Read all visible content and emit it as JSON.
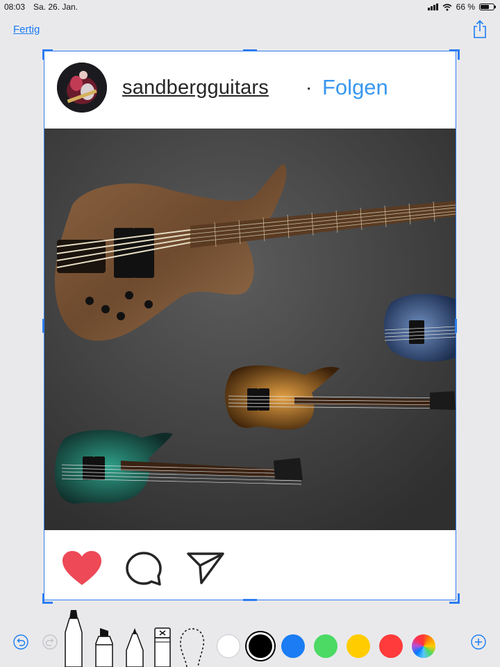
{
  "status_bar": {
    "time": "08:03",
    "date": "Sa. 26. Jan.",
    "battery_text": "66 %",
    "battery_level": 0.66
  },
  "nav": {
    "done_label": "Fertig",
    "share_icon": "share-icon"
  },
  "post": {
    "username": "sandbergguitars",
    "separator": "·",
    "follow_label": "Folgen",
    "image_subject": "bass-guitars-photo",
    "actions": [
      "heart-icon",
      "comment-icon",
      "send-icon"
    ]
  },
  "markup_toolbar": {
    "tools": [
      "undo-icon",
      "redo-icon",
      "marker-pen",
      "highlighter",
      "pencil",
      "eraser",
      "lasso"
    ],
    "colors": [
      "#ffffff",
      "#000000",
      "#1b7cf3",
      "#4cd964",
      "#ffcc00",
      "#ff3b3b",
      "spectrum"
    ],
    "selected_color": "#000000",
    "add_icon": "add-icon"
  },
  "colors": {
    "accent": "#1a7cf2",
    "selection": "#2d7df0",
    "instagram_blue": "#3897f0",
    "heart_red": "#ed4956"
  }
}
